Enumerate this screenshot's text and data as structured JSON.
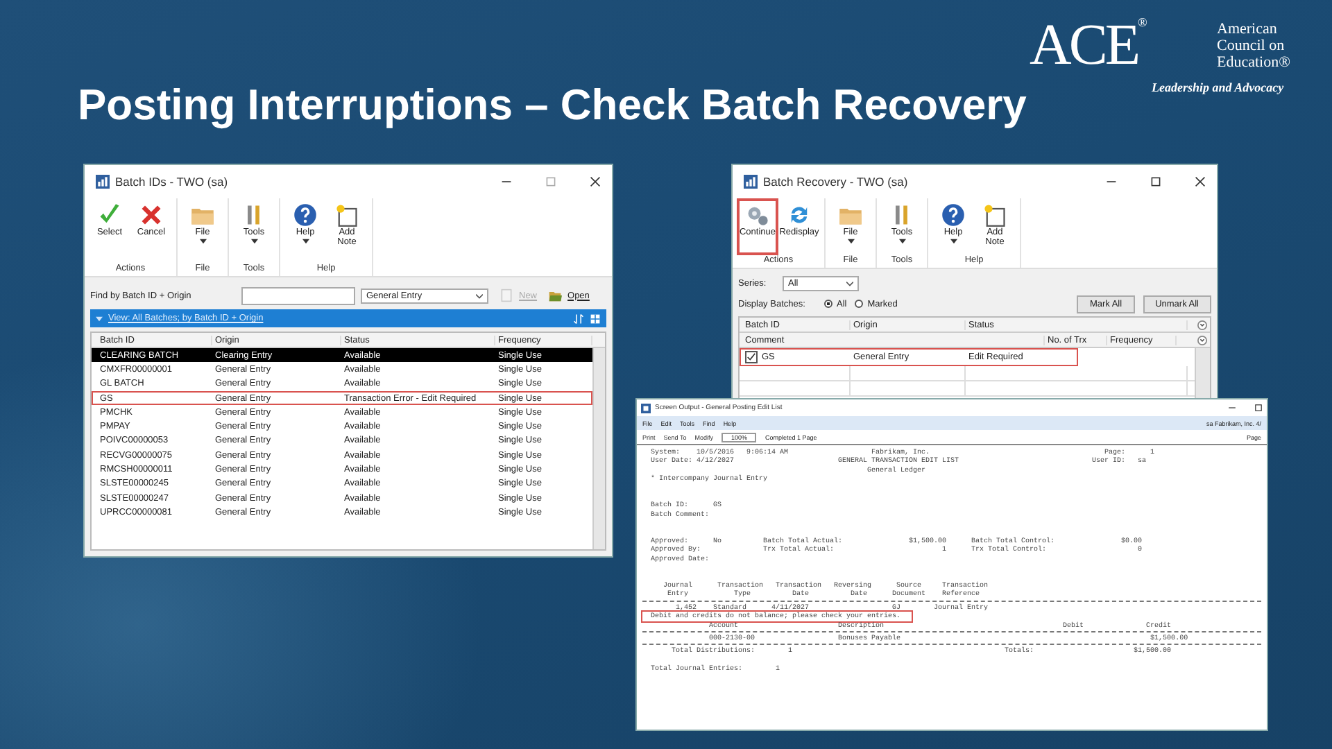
{
  "slide": {
    "title": "Posting Interruptions – Check Batch Recovery",
    "logo": {
      "mark": "ACE",
      "reg": "®",
      "name_lines": [
        "American",
        "Council on",
        "Education®"
      ],
      "tagline": "Leadership and Advocacy"
    }
  },
  "batch_ids": {
    "title": "Batch IDs  -  TWO (sa)",
    "ribbon": [
      {
        "label": "Actions",
        "buttons": [
          {
            "kind": "check",
            "label": "Select",
            "caret": false,
            "flagged": false
          },
          {
            "kind": "cross",
            "label": "Cancel",
            "caret": false,
            "flagged": false
          }
        ]
      },
      {
        "label": "File",
        "buttons": [
          {
            "kind": "folder",
            "label": "File",
            "caret": true,
            "flagged": false
          }
        ]
      },
      {
        "label": "Tools",
        "buttons": [
          {
            "kind": "tools",
            "label": "Tools",
            "caret": true,
            "flagged": false
          }
        ]
      },
      {
        "label": "Help",
        "buttons": [
          {
            "kind": "help",
            "label": "Help",
            "caret": true,
            "flagged": false
          },
          {
            "kind": "note",
            "label": "Add Note",
            "caret": false,
            "flagged": false
          }
        ]
      }
    ],
    "find_label": "Find by Batch ID + Origin",
    "origin_value": "General Entry",
    "new_label": "New",
    "new_disabled": true,
    "open_label": "Open",
    "view_label": "View: All Batches; by Batch ID + Origin",
    "columns": [
      "Batch ID",
      "Origin",
      "Status",
      "Frequency"
    ],
    "rows": [
      {
        "cells": [
          "CLEARING BATCH",
          "Clearing Entry",
          "Available",
          "Single Use"
        ],
        "selected": true,
        "flagged": false
      },
      {
        "cells": [
          "CMXFR00000001",
          "General Entry",
          "Available",
          "Single Use"
        ],
        "selected": false,
        "flagged": false
      },
      {
        "cells": [
          "GL BATCH",
          "General Entry",
          "Available",
          "Single Use"
        ],
        "selected": false,
        "flagged": false
      },
      {
        "cells": [
          "GS",
          "General Entry",
          "Transaction Error - Edit Required",
          "Single Use"
        ],
        "selected": false,
        "flagged": true
      },
      {
        "cells": [
          "PMCHK",
          "General Entry",
          "Available",
          "Single Use"
        ],
        "selected": false,
        "flagged": false
      },
      {
        "cells": [
          "PMPAY",
          "General Entry",
          "Available",
          "Single Use"
        ],
        "selected": false,
        "flagged": false
      },
      {
        "cells": [
          "POIVC00000053",
          "General Entry",
          "Available",
          "Single Use"
        ],
        "selected": false,
        "flagged": false
      },
      {
        "cells": [
          "RECVG00000075",
          "General Entry",
          "Available",
          "Single Use"
        ],
        "selected": false,
        "flagged": false
      },
      {
        "cells": [
          "RMCSH00000011",
          "General Entry",
          "Available",
          "Single Use"
        ],
        "selected": false,
        "flagged": false
      },
      {
        "cells": [
          "SLSTE00000245",
          "General Entry",
          "Available",
          "Single Use"
        ],
        "selected": false,
        "flagged": false
      },
      {
        "cells": [
          "SLSTE00000247",
          "General Entry",
          "Available",
          "Single Use"
        ],
        "selected": false,
        "flagged": false
      },
      {
        "cells": [
          "UPRCC00000081",
          "General Entry",
          "Available",
          "Single Use"
        ],
        "selected": false,
        "flagged": false
      }
    ]
  },
  "batch_recovery": {
    "title": "Batch Recovery  -  TWO (sa)",
    "ribbon": [
      {
        "label": "Actions",
        "buttons": [
          {
            "kind": "gears",
            "label": "Continue",
            "caret": false,
            "flagged": true
          },
          {
            "kind": "refresh",
            "label": "Redisplay",
            "caret": false,
            "flagged": false
          }
        ]
      },
      {
        "label": "File",
        "buttons": [
          {
            "kind": "folder",
            "label": "File",
            "caret": true,
            "flagged": false
          }
        ]
      },
      {
        "label": "Tools",
        "buttons": [
          {
            "kind": "tools",
            "label": "Tools",
            "caret": true,
            "flagged": false
          }
        ]
      },
      {
        "label": "Help",
        "buttons": [
          {
            "kind": "help",
            "label": "Help",
            "caret": true,
            "flagged": false
          },
          {
            "kind": "note",
            "label": "Add Note",
            "caret": false,
            "flagged": false
          }
        ]
      }
    ],
    "series_label": "Series:",
    "series_value": "All",
    "display_label": "Display Batches:",
    "radios": [
      {
        "label": "All",
        "selected": true
      },
      {
        "label": "Marked",
        "selected": false
      }
    ],
    "buttons": [
      "Mark All",
      "Unmark All"
    ],
    "columns": [
      "Batch ID",
      "Origin",
      "Status"
    ],
    "columns_2": [
      "Comment",
      "No. of Trx",
      "Frequency"
    ],
    "rows": [
      {
        "checked": true,
        "cells": [
          "GS",
          "General Entry",
          "Edit Required"
        ],
        "flagged": true
      }
    ]
  },
  "report": {
    "title": "Screen Output - General Posting Edit List",
    "menu": [
      "File",
      "Edit",
      "Tools",
      "Find",
      "Help"
    ],
    "menu_right": "sa  Fabrikam, Inc.  4/",
    "toolbar": [
      "Print",
      "Send To",
      "Modify"
    ],
    "zoom": "100%",
    "status": "Completed 1 Page",
    "page_label": "Page",
    "lines": [
      {
        "kind": "text",
        "text": "  System:    10/5/2016   9:06:14 AM                    Fabrikam, Inc.                                          Page:      1"
      },
      {
        "kind": "text",
        "text": "  User Date: 4/12/2027                         GENERAL TRANSACTION EDIT LIST                                User ID:   sa"
      },
      {
        "kind": "text",
        "text": "                                                      General Ledger"
      },
      {
        "kind": "text",
        "text": "  * Intercompany Journal Entry"
      },
      {
        "kind": "blank"
      },
      {
        "kind": "blank"
      },
      {
        "kind": "text",
        "text": "  Batch ID:      GS"
      },
      {
        "kind": "text",
        "text": "  Batch Comment:"
      },
      {
        "kind": "blank"
      },
      {
        "kind": "blank"
      },
      {
        "kind": "text",
        "text": "  Approved:      No          Batch Total Actual:                $1,500.00      Batch Total Control:                $0.00"
      },
      {
        "kind": "text",
        "text": "  Approved By:               Trx Total Actual:                          1      Trx Total Control:                      0"
      },
      {
        "kind": "text",
        "text": "  Approved Date:"
      },
      {
        "kind": "blank"
      },
      {
        "kind": "blank"
      },
      {
        "kind": "text",
        "text": "     Journal      Transaction   Transaction   Reversing      Source     Transaction"
      },
      {
        "kind": "text",
        "text": "      Entry           Type          Date          Date      Document    Reference"
      },
      {
        "kind": "rule"
      },
      {
        "kind": "text",
        "text": "        1,452    Standard      4/11/2027                    GJ        Journal Entry"
      },
      {
        "kind": "flagged",
        "text": "  Debit and credits do not balance; please check your entries."
      },
      {
        "kind": "text",
        "text": "                Account                        Description                                           Debit               Credit"
      },
      {
        "kind": "rule"
      },
      {
        "kind": "text",
        "text": "                000-2130-00                    Bonuses Payable                                                            $1,500.00"
      },
      {
        "kind": "rule"
      },
      {
        "kind": "text",
        "text": "       Total Distributions:        1                                                   Totals:                        $1,500.00"
      },
      {
        "kind": "blank"
      },
      {
        "kind": "text",
        "text": "  Total Journal Entries:        1"
      }
    ]
  }
}
